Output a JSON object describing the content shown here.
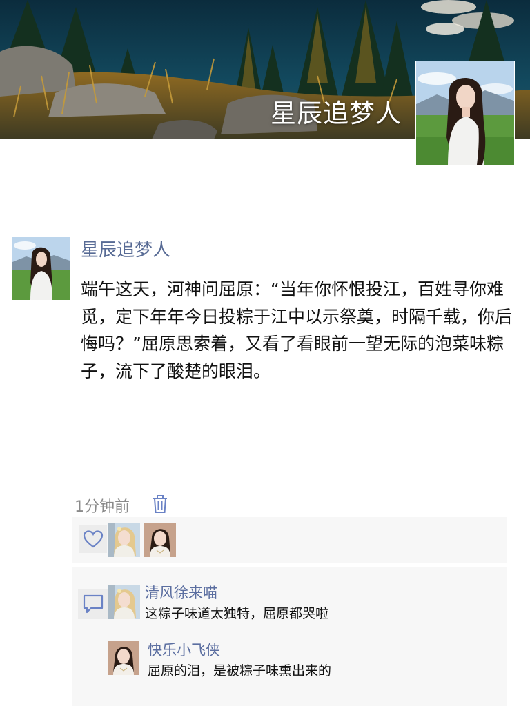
{
  "profile": {
    "name": "星辰追梦人",
    "cover_image": "forest-lake-landscape-photo",
    "avatar_image": "woman-in-white-on-meadow-portrait"
  },
  "post": {
    "author": "星辰追梦人",
    "text": "端午这天，河神问屈原：“当年你怀恨投江，百姓寻你难觅，定下年年今日投粽于江中以示祭奠，时隔千载，你后悔吗？”屈原思索着，又看了看眼前一望无际的泡菜味粽子，流下了酸楚的眼泪。",
    "timestamp": "1分钟前",
    "delete_icon": "trash-icon"
  },
  "likes": {
    "icon": "heart-icon",
    "users": [
      "blonde-girl-avatar",
      "dark-hair-girl-avatar"
    ]
  },
  "comments": {
    "icon": "comment-icon",
    "items": [
      {
        "user": "清风徐来喵",
        "text": "这粽子味道太独特，屈原都哭啦",
        "avatar": "blonde-girl-avatar"
      },
      {
        "user": "快乐小飞侠",
        "text": "屈原的泪，是被粽子味熏出来的",
        "avatar": "dark-hair-girl-avatar"
      }
    ]
  },
  "colors": {
    "link_blue": "#586b95",
    "icon_blue": "#6a82c5",
    "panel_bg": "#f7f7f7",
    "meta_gray": "#8a8a8a"
  }
}
